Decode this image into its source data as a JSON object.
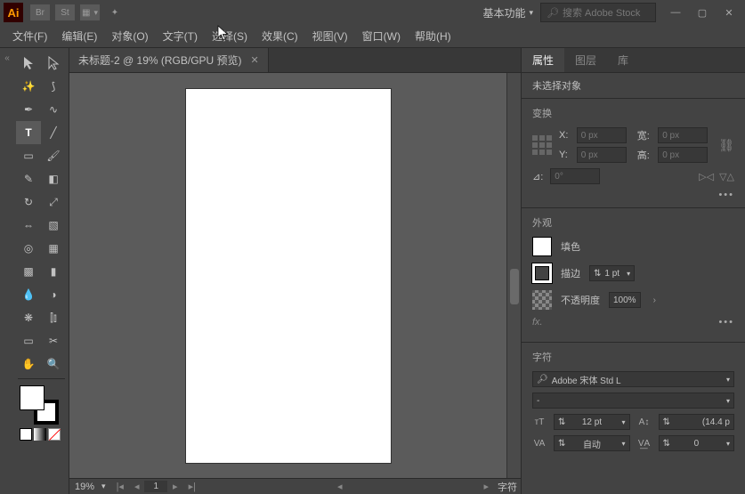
{
  "app": {
    "icon_text": "Ai",
    "bridge": "Br",
    "stock": "St"
  },
  "workspace": {
    "label": "基本功能"
  },
  "search": {
    "placeholder": "搜索 Adobe Stock"
  },
  "menu": {
    "file": "文件(F)",
    "edit": "编辑(E)",
    "object": "对象(O)",
    "type": "文字(T)",
    "select": "选择(S)",
    "effect": "效果(C)",
    "view": "视图(V)",
    "window": "窗口(W)",
    "help": "帮助(H)"
  },
  "document": {
    "tab_title": "未标题-2 @ 19% (RGB/GPU 预览)",
    "zoom": "19%",
    "page": "1",
    "footer_label": "字符"
  },
  "panels": {
    "tabs": {
      "props": "属性",
      "layers": "图层",
      "libs": "库"
    },
    "no_selection": "未选择对象",
    "transform": {
      "title": "变换",
      "x_label": "X:",
      "y_label": "Y:",
      "w_label": "宽:",
      "h_label": "高:",
      "x": "0 px",
      "y": "0 px",
      "w": "0 px",
      "h": "0 px",
      "angle_label": "⊿:",
      "angle": "0°"
    },
    "appearance": {
      "title": "外观",
      "fill_label": "填色",
      "stroke_label": "描边",
      "stroke_val": "1 pt",
      "opacity_label": "不透明度",
      "opacity_val": "100%",
      "fx": "fx."
    },
    "character": {
      "title": "字符",
      "font": "Adobe 宋体 Std L",
      "style": "-",
      "size": "12 pt",
      "leading": "(14.4 p",
      "kerning": "自动",
      "tracking": "0"
    }
  }
}
